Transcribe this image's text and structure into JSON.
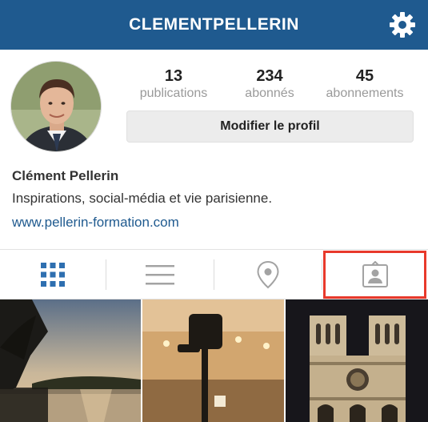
{
  "header": {
    "title": "CLEMENTPELLERIN",
    "background_color": "#1f5a8f",
    "settings_icon": "gear-icon"
  },
  "profile": {
    "stats": [
      {
        "count": "13",
        "label": "publications"
      },
      {
        "count": "234",
        "label": "abonnés"
      },
      {
        "count": "45",
        "label": "abonnements"
      }
    ],
    "edit_button_label": "Modifier le profil",
    "name": "Clément Pellerin",
    "bio": "Inspirations, social-média et vie parisienne.",
    "website": "www.pellerin-formation.com"
  },
  "tabs": [
    {
      "icon": "grid-icon",
      "active": true
    },
    {
      "icon": "list-icon",
      "active": false
    },
    {
      "icon": "location-pin-icon",
      "active": false
    },
    {
      "icon": "tagged-person-icon",
      "active": false,
      "highlighted": true
    }
  ],
  "highlight_color": "#e8392b",
  "photos": [
    {
      "subject": "lake-sunset-photo"
    },
    {
      "subject": "camera-studio-photo"
    },
    {
      "subject": "notre-dame-night-photo"
    }
  ]
}
